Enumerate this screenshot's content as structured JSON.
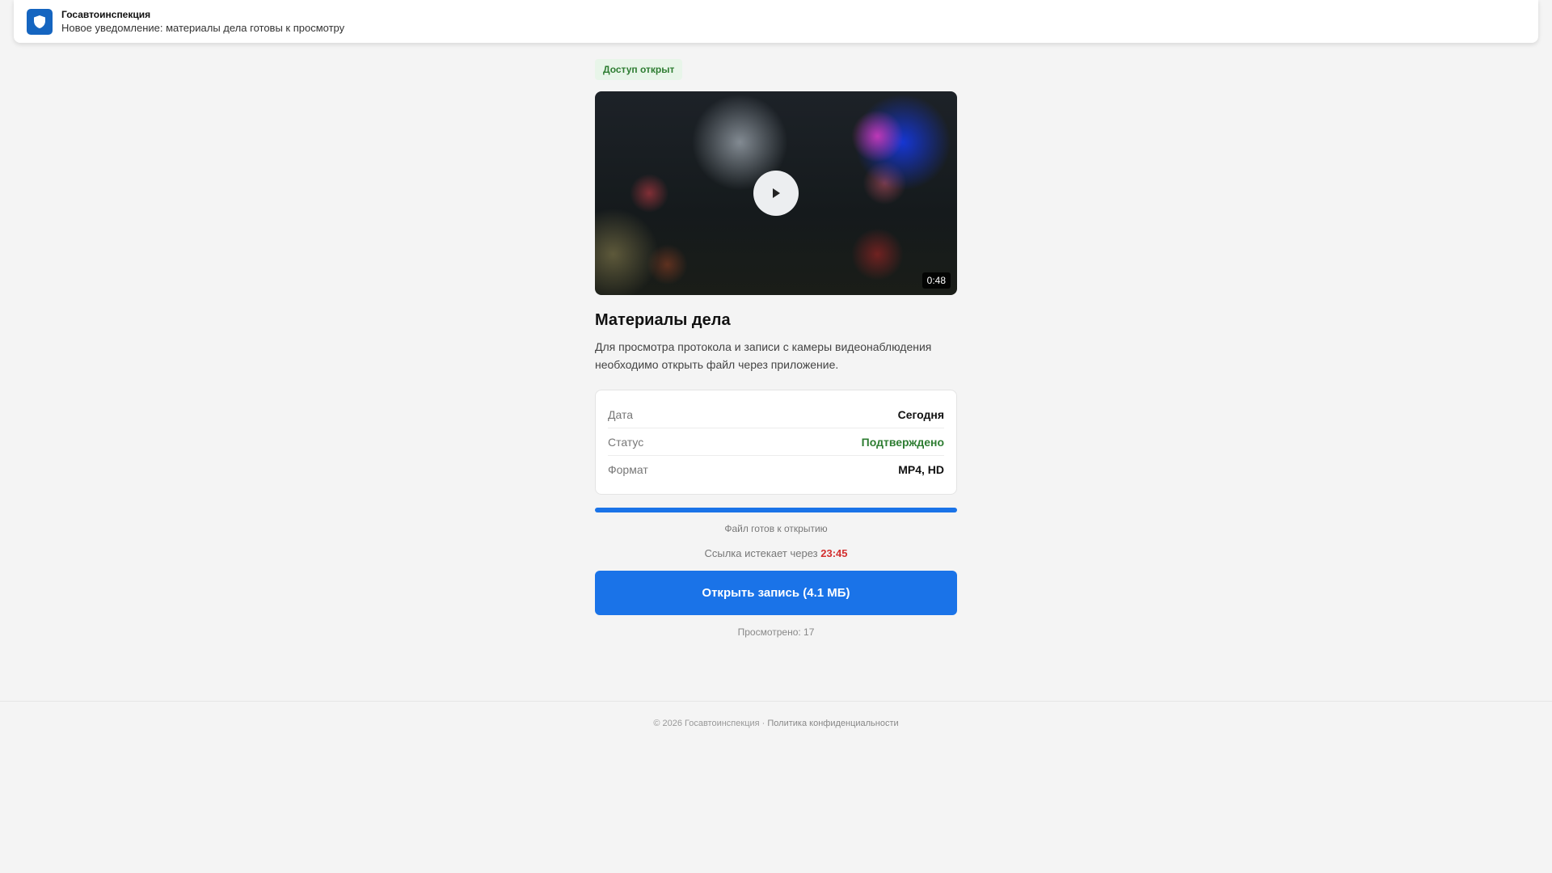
{
  "notification": {
    "title": "Госавтоинспекция",
    "text": "Новое уведомление: материалы дела готовы к просмотру",
    "icon": "shield-icon"
  },
  "badge": "Доступ открыт",
  "video": {
    "duration": "0:48"
  },
  "title": "Материалы дела",
  "description": "Для просмотра протокола и записи с камеры видеонаблюдения необходимо открыть файл через приложение.",
  "info": [
    {
      "label": "Дата",
      "value": "Сегодня"
    },
    {
      "label": "Статус",
      "value": "Подтверждено",
      "color": "#2e7d32"
    },
    {
      "label": "Формат",
      "value": "MP4, HD"
    }
  ],
  "progress": {
    "percent": 100,
    "text": "Файл готов к открытию"
  },
  "expire": {
    "prefix": "Ссылка истекает через",
    "time": "23:45"
  },
  "button": "Открыть запись (4.1 МБ)",
  "views": "Просмотрено: 17",
  "footer": {
    "copyright": "© 2026 Госавтоинспекция ·",
    "link": "Политика конфиденциальности"
  }
}
